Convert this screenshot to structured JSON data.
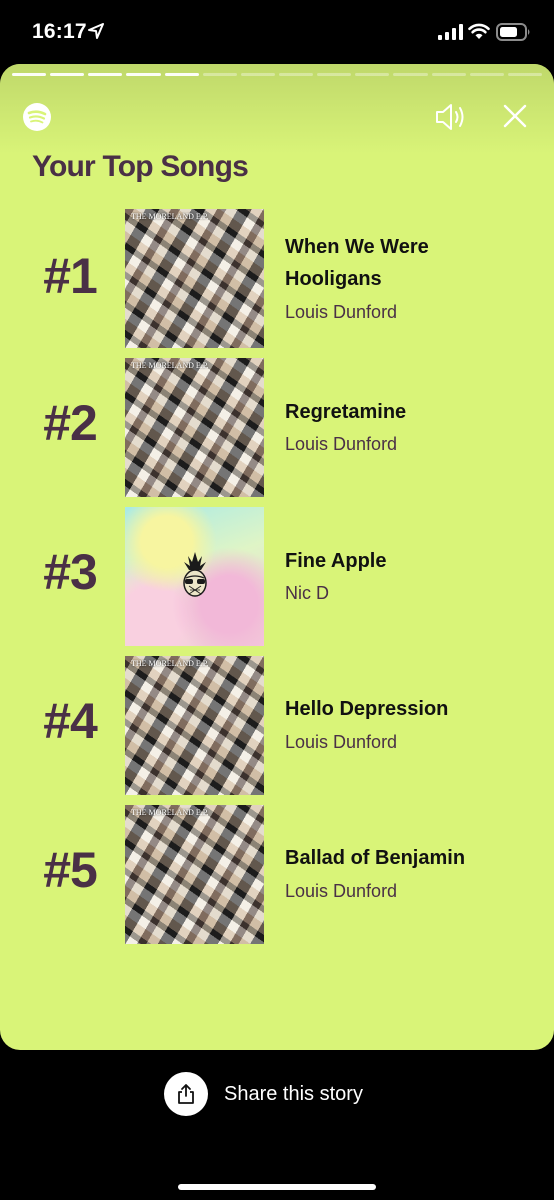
{
  "status_bar": {
    "time": "16:17"
  },
  "story": {
    "progress": {
      "total_segments": 14,
      "completed_segments": 5
    },
    "title": "Your Top Songs",
    "songs": [
      {
        "rank": "#1",
        "title_line1": "When We Were",
        "title_line2": "Hooligans",
        "artist": "Louis Dunford",
        "art": "collage"
      },
      {
        "rank": "#2",
        "title_line1": "Regretamine",
        "title_line2": "",
        "artist": "Louis Dunford",
        "art": "collage"
      },
      {
        "rank": "#3",
        "title_line1": "Fine Apple",
        "title_line2": "",
        "artist": "Nic D",
        "art": "pastel"
      },
      {
        "rank": "#4",
        "title_line1": "Hello Depression",
        "title_line2": "",
        "artist": "Louis Dunford",
        "art": "collage"
      },
      {
        "rank": "#5",
        "title_line1": "Ballad of Benjamin",
        "title_line2": "",
        "artist": "Louis Dunford",
        "art": "collage"
      }
    ],
    "album_caption": "THE MORELAND E.P."
  },
  "share": {
    "label": "Share this story"
  },
  "colors": {
    "background": "#d9f478",
    "rank": "#4a3046",
    "accent_dark": "#000000"
  },
  "icons": [
    "location-arrow-icon",
    "signal-icon",
    "wifi-icon",
    "battery-icon",
    "spotify-icon",
    "speaker-icon",
    "close-icon",
    "share-icon"
  ]
}
